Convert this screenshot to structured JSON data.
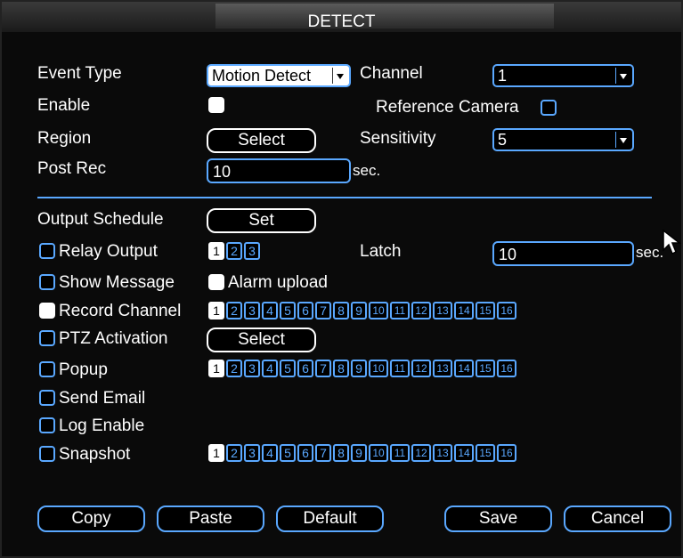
{
  "window": {
    "title": "DETECT"
  },
  "form": {
    "event_type_label": "Event Type",
    "event_type_value": "Motion Detect",
    "channel_label": "Channel",
    "channel_value": "1",
    "enable_label": "Enable",
    "reference_camera_label": "Reference Camera",
    "region_label": "Region",
    "region_button": "Select",
    "sensitivity_label": "Sensitivity",
    "sensitivity_value": "5",
    "post_rec_label": "Post Rec",
    "post_rec_value": "10",
    "post_rec_unit": "sec."
  },
  "actions": {
    "output_schedule_label": "Output Schedule",
    "output_schedule_button": "Set",
    "relay_output_label": "Relay Output",
    "relay_channels": [
      "1",
      "2",
      "3"
    ],
    "latch_label": "Latch",
    "latch_value": "10",
    "latch_unit": "sec.",
    "show_message_label": "Show Message",
    "alarm_upload_label": "Alarm upload",
    "record_channel_label": "Record Channel",
    "ptz_activation_label": "PTZ Activation",
    "ptz_button": "Select",
    "popup_label": "Popup",
    "send_email_label": "Send Email",
    "log_enable_label": "Log Enable",
    "snapshot_label": "Snapshot",
    "channels16": [
      "1",
      "2",
      "3",
      "4",
      "5",
      "6",
      "7",
      "8",
      "9",
      "10",
      "11",
      "12",
      "13",
      "14",
      "15",
      "16"
    ]
  },
  "buttons": {
    "copy": "Copy",
    "paste": "Paste",
    "default": "Default",
    "save": "Save",
    "cancel": "Cancel"
  },
  "colors": {
    "accent": "#5aa8ff",
    "background": "#0a0a0a",
    "text": "#ffffff"
  }
}
